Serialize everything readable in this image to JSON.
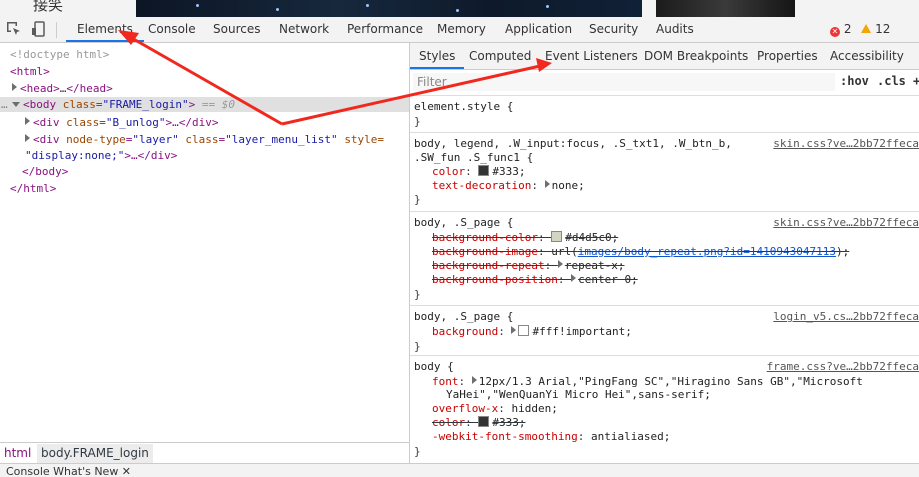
{
  "top_strip": {
    "chars": "接笑"
  },
  "toolbar": {
    "tabs": [
      {
        "label": "Elements"
      },
      {
        "label": "Console"
      },
      {
        "label": "Sources"
      },
      {
        "label": "Network"
      },
      {
        "label": "Performance"
      },
      {
        "label": "Memory"
      },
      {
        "label": "Application"
      },
      {
        "label": "Security"
      },
      {
        "label": "Audits"
      }
    ],
    "active_tab": "Elements",
    "error_count": "2",
    "warning_count": "12",
    "error_color": "#e33333",
    "warning_color": "#f2a600",
    "accent_color": "#1a73e8"
  },
  "dom": {
    "doctype": "<!doctype html>",
    "html_open": "<html>",
    "head": {
      "open": "<head>",
      "ellipsis": "…",
      "close": "</head>"
    },
    "body": {
      "tag_open": "<body",
      "attr_name": "class",
      "attr_value": "\"FRAME_login\"",
      "tag_close": ">",
      "marker": "== $0"
    },
    "div1": {
      "tag_open": "<div",
      "attr_name": "class",
      "attr_value": "\"B_unlog\"",
      "tag_end": ">…</div>"
    },
    "div2": {
      "tag_open": "<div",
      "attr1_name": "node-type",
      "attr1_value": "\"layer\"",
      "attr2_name": "class",
      "attr2_value": "\"layer_menu_list\"",
      "attr3_name": "style=",
      "attr3_value": "\"display:none;\"",
      "tag_end": ">…</div>"
    },
    "body_close": "</body>",
    "html_close": "</html>"
  },
  "breadcrumbs": [
    {
      "label": "html"
    },
    {
      "label": "body.FRAME_login"
    }
  ],
  "bottom_strip": {
    "text": "Console   What's New ✕"
  },
  "styles": {
    "sub_tabs": [
      {
        "label": "Styles"
      },
      {
        "label": "Computed"
      },
      {
        "label": "Event Listeners"
      },
      {
        "label": "DOM Breakpoints"
      },
      {
        "label": "Properties"
      },
      {
        "label": "Accessibility"
      }
    ],
    "filter_placeholder": "Filter",
    "hov_label": ":hov",
    "cls_label": ".cls",
    "plus_label": "+",
    "rules": [
      {
        "selector": "element.style {",
        "close": "}"
      },
      {
        "selector_line1": "body, legend, .W_input:focus, .S_txt1, .W_btn_b,",
        "selector_line2": ".SW_fun .S_func1 {",
        "source": "skin.css?ve…2bb72ffeca",
        "props": [
          {
            "name": "color",
            "value": "#333;",
            "swatch": "#333333"
          },
          {
            "name": "text-decoration",
            "value": "none;"
          }
        ],
        "close": "}"
      },
      {
        "selector": "body, .S_page {",
        "source": "skin.css?ve…2bb72ffeca",
        "props": [
          {
            "name": "background-color",
            "value": "#d4d5c0;",
            "swatch": "#d4d5c0"
          },
          {
            "name": "background-image",
            "value_pre": "url(",
            "value_link": "images/body_repeat.png?id=1410943047113",
            "value_post": ");"
          },
          {
            "name": "background-repeat",
            "value": "repeat-x;"
          },
          {
            "name": "background-position",
            "value": "center 0;"
          }
        ],
        "close": "}"
      },
      {
        "selector": "body, .S_page {",
        "source": "login_v5.cs…2bb72ffeca",
        "props": [
          {
            "name": "background",
            "value": "#fff!important;",
            "swatch": "#ffffff"
          }
        ],
        "close": "}"
      },
      {
        "selector": "body {",
        "source": "frame.css?ve…2bb72ffeca",
        "props": [
          {
            "name": "font",
            "value_line1": "12px/1.3 Arial,\"PingFang SC\",\"Hiragino Sans GB\",\"Microsoft",
            "value_line2": "YaHei\",\"WenQuanYi Micro Hei\",sans-serif;"
          },
          {
            "name": "overflow-x",
            "value": "hidden;"
          },
          {
            "name": "color",
            "value": "#333;",
            "swatch": "#333333"
          },
          {
            "name": "-webkit-font-smoothing",
            "value": "antialiased;"
          }
        ],
        "close": "}"
      }
    ]
  }
}
